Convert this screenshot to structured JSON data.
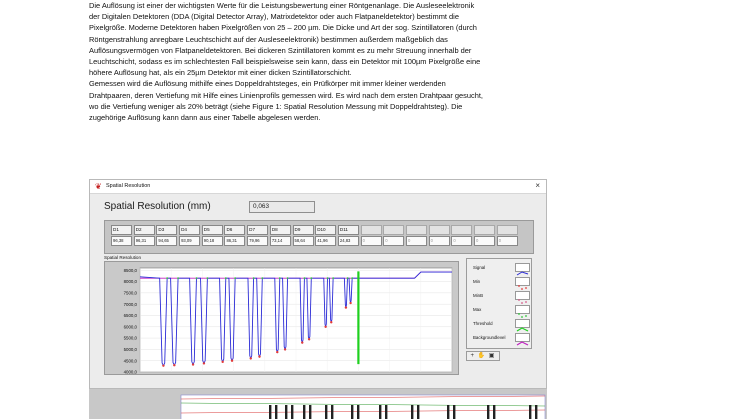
{
  "document": {
    "paragraphs": [
      "Die Auflösung ist einer der wichtigsten Werte für die Leistungsbewertung einer Röntgenanlage. Die Ausleseelektronik",
      "der Digitalen Detektoren (DDA (Digital Detector Array), Matrixdetektor oder auch Flatpaneldetektor) bestimmt die",
      "Pixelgröße. Moderne Detektoren haben Pixelgrößen von 25 – 200 µm. Die Dicke und Art der sog. Szintillatoren (durch",
      "Röntgenstrahlung anregbare Leuchtschicht auf der Ausleseelektronik) bestimmen außerdem maßgeblich das",
      "Auflösungsvermögen von Flatpaneldetektoren. Bei dickeren Szintillatoren kommt es zu mehr Streuung innerhalb der",
      "Leuchtschicht, sodass es im schlechtesten Fall beispielsweise sein kann, dass ein Detektor mit 100µm Pixelgröße eine",
      "höhere Auflösung hat, als ein 25µm Detektor mit einer dicken Szintillatorschicht.",
      "Gemessen wird die Auflösung mithilfe eines Doppeldrahtsteges, ein Prüfkörper mit immer kleiner werdenden",
      "Drahtpaaren, deren Vertiefung mit Hilfe eines Linienprofils gemessen wird. Es wird nach dem ersten Drahtpaar gesucht,",
      "wo die Vertiefung weniger als 20% beträgt (siehe Figure 1: Spatial Resolution Messung mit Doppeldrahtsteg). Die",
      "zugehörige Auflösung kann dann aus einer Tabelle abgelesen werden."
    ]
  },
  "window": {
    "title": "Spatial Resolution",
    "close": "×",
    "resolution_label": "Spatial Resolution (mm)",
    "resolution_value": "0,063"
  },
  "detectors": [
    {
      "label": "D1",
      "value": "96,38"
    },
    {
      "label": "D2",
      "value": "96,31"
    },
    {
      "label": "D3",
      "value": "94,65"
    },
    {
      "label": "D4",
      "value": "93,09"
    },
    {
      "label": "D5",
      "value": "90,18"
    },
    {
      "label": "D6",
      "value": "86,31"
    },
    {
      "label": "D7",
      "value": "79,96"
    },
    {
      "label": "D8",
      "value": "73,14"
    },
    {
      "label": "D9",
      "value": "58,64"
    },
    {
      "label": "D10",
      "value": "41,96"
    },
    {
      "label": "D11",
      "value": "24,83"
    },
    {
      "label": "",
      "value": "0"
    },
    {
      "label": "",
      "value": "0"
    },
    {
      "label": "",
      "value": "0"
    },
    {
      "label": "",
      "value": "0"
    },
    {
      "label": "",
      "value": "0"
    },
    {
      "label": "",
      "value": "0"
    },
    {
      "label": "",
      "value": "0"
    }
  ],
  "chart_data": {
    "type": "line",
    "title": "Spatial Resolution",
    "ylim": [
      4000,
      8600
    ],
    "y_ticks": [
      "8500,0",
      "8000,0",
      "7500,0",
      "7000,0",
      "6500,0",
      "6000,0",
      "5500,0",
      "5000,0",
      "4500,0",
      "4000,0"
    ],
    "y_tick_values": [
      8500,
      8000,
      7500,
      7000,
      6500,
      6000,
      5500,
      5000,
      4500,
      4000
    ],
    "grid": true,
    "xlim": [
      0,
      100
    ],
    "background_level": 8150,
    "dips": [
      {
        "x": 7.5,
        "min": 4280,
        "width": 1.2
      },
      {
        "x": 11.0,
        "min": 4300,
        "width": 1.2
      },
      {
        "x": 17.0,
        "min": 4330,
        "width": 1.1
      },
      {
        "x": 20.5,
        "min": 4380,
        "width": 1.1
      },
      {
        "x": 26.5,
        "min": 4450,
        "width": 1.0
      },
      {
        "x": 29.5,
        "min": 4500,
        "width": 1.0
      },
      {
        "x": 35.5,
        "min": 4600,
        "width": 0.9
      },
      {
        "x": 38.3,
        "min": 4680,
        "width": 0.9
      },
      {
        "x": 44.0,
        "min": 4880,
        "width": 0.8
      },
      {
        "x": 46.5,
        "min": 5000,
        "width": 0.8
      },
      {
        "x": 52.0,
        "min": 5300,
        "width": 0.7
      },
      {
        "x": 54.2,
        "min": 5450,
        "width": 0.7
      },
      {
        "x": 59.5,
        "min": 6000,
        "width": 0.6
      },
      {
        "x": 61.3,
        "min": 6200,
        "width": 0.6
      },
      {
        "x": 66.0,
        "min": 6850,
        "width": 0.5
      },
      {
        "x": 67.5,
        "min": 7050,
        "width": 0.5
      }
    ],
    "threshold_x": 70.0,
    "end_step": {
      "x1": 88,
      "y1": 8150,
      "x2": 90,
      "y2": 8420
    },
    "series_colors": {
      "Signal": "#2b2bd6",
      "Min": "#e23b3b",
      "MinB": "#d85a8a",
      "Max": "#2fc93a",
      "Threshold": "#1fd01f",
      "Backgroundlevel": "#c020c0"
    },
    "legend": [
      "Signal",
      "Min",
      "MinB",
      "Max",
      "Threshold",
      "Backgroundlevel"
    ]
  },
  "icons": {
    "app": "labview-logo-icon",
    "palette": "graph-palette-icon"
  },
  "palette_glyphs": "+ ✋ ▣"
}
